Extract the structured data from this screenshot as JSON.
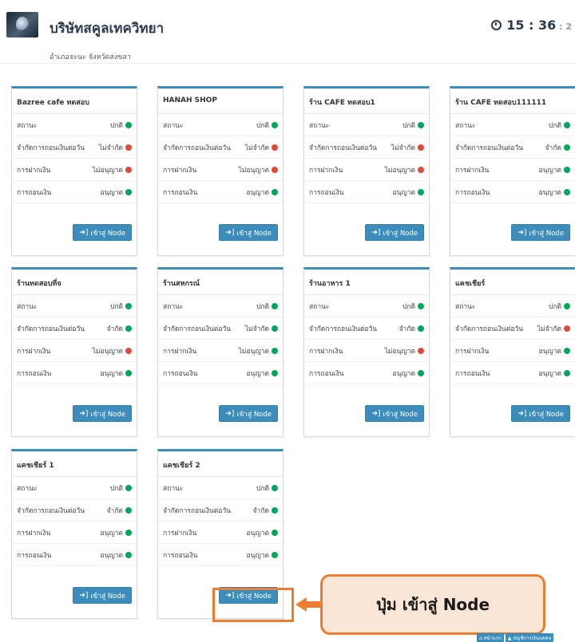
{
  "header": {
    "company_name": "บริษัทสคูลเทควิทยา",
    "address": "อำเภอจะนะ จังหวัดสงขลา",
    "clock_time": "15 : 36",
    "clock_seconds": " : 2"
  },
  "labels": {
    "status": "สถานะ",
    "daily_limit": "จำกัดการถอนเงินต่อวัน",
    "deposit": "การฝากเงิน",
    "withdraw": "การถอนเงิน",
    "node_button": "เข้าสู่ Node"
  },
  "nodes": [
    {
      "title": "Bazree cafe ทดสอบ",
      "status": "ปกติ",
      "status_color": "green",
      "limit": "ไม่จำกัด",
      "limit_color": "red",
      "deposit": "ไม่อนุญาต",
      "deposit_color": "red",
      "withdraw": "อนุญาต",
      "withdraw_color": "green"
    },
    {
      "title": "HANAH SHOP",
      "status": "ปกติ",
      "status_color": "green",
      "limit": "ไม่จำกัด",
      "limit_color": "red",
      "deposit": "ไม่อนุญาต",
      "deposit_color": "red",
      "withdraw": "อนุญาต",
      "withdraw_color": "green"
    },
    {
      "title": "ร้าน CAFE ทดสอบ1",
      "status": "ปกติ",
      "status_color": "green",
      "limit": "ไม่จำกัด",
      "limit_color": "red",
      "deposit": "ไม่อนุญาต",
      "deposit_color": "red",
      "withdraw": "อนุญาต",
      "withdraw_color": "green"
    },
    {
      "title": "ร้าน CAFE ทดสอบ111111",
      "status": "ปกติ",
      "status_color": "green",
      "limit": "จำกัด",
      "limit_color": "green",
      "deposit": "อนุญาต",
      "deposit_color": "green",
      "withdraw": "อนุญาต",
      "withdraw_color": "green"
    },
    {
      "title": "ร้านทดสอบที่จ",
      "status": "ปกติ",
      "status_color": "green",
      "limit": "จำกัด",
      "limit_color": "green",
      "deposit": "ไม่อนุญาต",
      "deposit_color": "red",
      "withdraw": "อนุญาต",
      "withdraw_color": "green"
    },
    {
      "title": "ร้านสหกรณ์",
      "status": "ปกติ",
      "status_color": "green",
      "limit": "ไม่จำกัด",
      "limit_color": "green",
      "deposit": "ไม่อนุญาต",
      "deposit_color": "green",
      "withdraw": "อนุญาต",
      "withdraw_color": "green"
    },
    {
      "title": "ร้านอาหาร 1",
      "status": "ปกติ",
      "status_color": "green",
      "limit": "จำกัด",
      "limit_color": "green",
      "deposit": "ไม่อนุญาต",
      "deposit_color": "red",
      "withdraw": "อนุญาต",
      "withdraw_color": "green"
    },
    {
      "title": "แคชเชียร์",
      "status": "ปกติ",
      "status_color": "green",
      "limit": "ไม่จำกัด",
      "limit_color": "red",
      "deposit": "อนุญาต",
      "deposit_color": "green",
      "withdraw": "อนุญาต",
      "withdraw_color": "green"
    },
    {
      "title": "แคชเชียร์ 1",
      "status": "ปกติ",
      "status_color": "green",
      "limit": "จำกัด",
      "limit_color": "green",
      "deposit": "อนุญาต",
      "deposit_color": "green",
      "withdraw": "อนุญาต",
      "withdraw_color": "green"
    },
    {
      "title": "แคชเชียร์ 2",
      "status": "ปกติ",
      "status_color": "green",
      "limit": "จำกัด",
      "limit_color": "green",
      "deposit": "อนุญาต",
      "deposit_color": "green",
      "withdraw": "อนุญาต",
      "withdraw_color": "green"
    }
  ],
  "callout": {
    "text": "ปุ่ม เข้าสู่ Node"
  },
  "footer": {
    "home_label": "หน้าแรก",
    "account_label": "บัญชีการเงินบุคคล"
  },
  "colors": {
    "primary": "#3c8dbc",
    "green": "#00a65a",
    "red": "#dd4b39",
    "callout_border": "#ed7d31",
    "callout_fill": "#fbe5d6"
  }
}
